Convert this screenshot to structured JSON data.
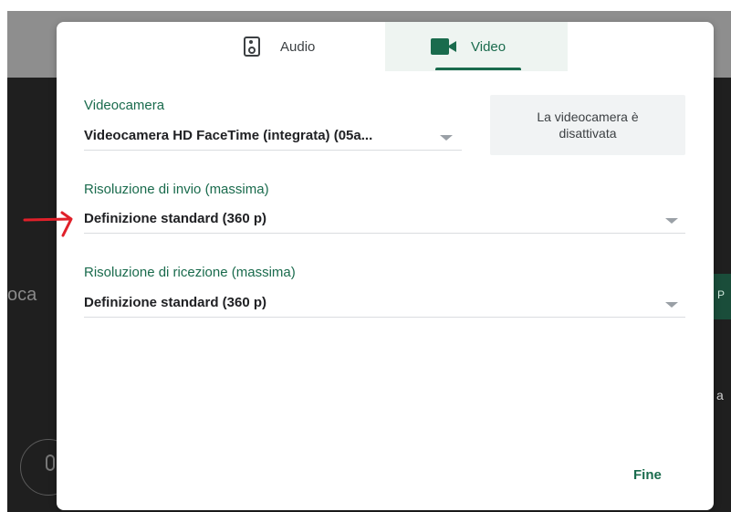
{
  "background": {
    "left_partial_text": "oca",
    "right_button_text": "P",
    "right_partial_text": "a"
  },
  "tabs": [
    {
      "label": "Audio",
      "icon": "speaker-icon",
      "selected": false
    },
    {
      "label": "Video",
      "icon": "video-camera-icon",
      "selected": true
    }
  ],
  "camera": {
    "label": "Videocamera",
    "value": "Videocamera HD FaceTime (integrata) (05a...",
    "preview_text": "La videocamera è disattivata"
  },
  "send_resolution": {
    "label": "Risoluzione di invio (massima)",
    "value": "Definizione standard (360 p)"
  },
  "receive_resolution": {
    "label": "Risoluzione di ricezione (massima)",
    "value": "Definizione standard (360 p)"
  },
  "actions": {
    "done_label": "Fine"
  },
  "colors": {
    "accent": "#1a6b4d",
    "annotation": "#e0202a",
    "tab_selected_bg": "#eef4f1"
  }
}
